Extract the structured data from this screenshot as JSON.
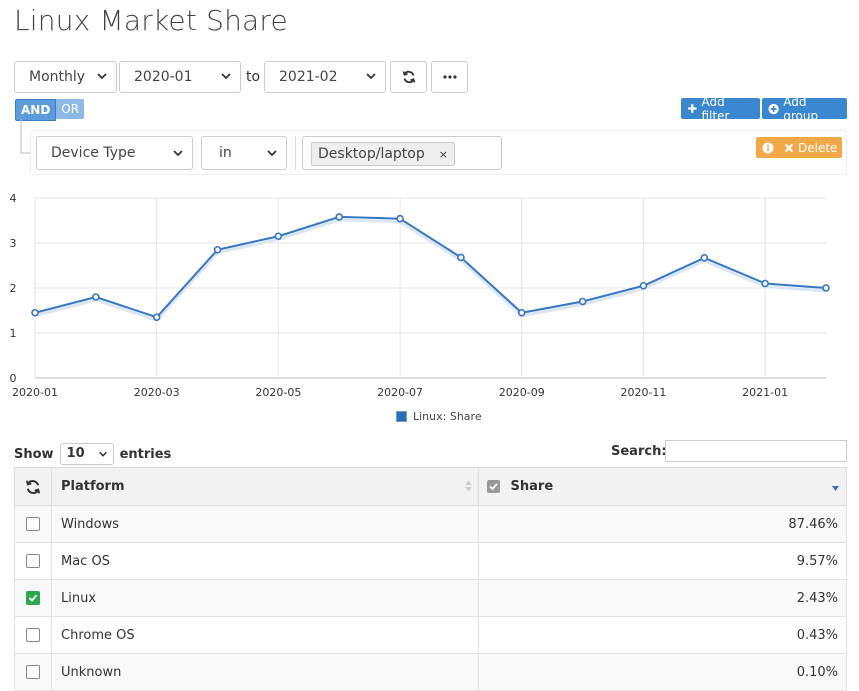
{
  "page": {
    "title": "Linux Market Share"
  },
  "toolbar": {
    "period": "Monthly",
    "from": "2020-01",
    "to_label": "to",
    "to": "2021-02"
  },
  "filter": {
    "and_label": "AND",
    "or_label": "OR",
    "add_filter": "Add filter",
    "add_group": "Add group",
    "field": "Device Type",
    "operator": "in",
    "value_tag": "Desktop/laptop",
    "tag_remove": "×",
    "delete": "Delete"
  },
  "chart_data": {
    "type": "line",
    "x": [
      "2020-01",
      "2020-02",
      "2020-03",
      "2020-04",
      "2020-05",
      "2020-06",
      "2020-07",
      "2020-08",
      "2020-09",
      "2020-10",
      "2020-11",
      "2020-12",
      "2021-01",
      "2021-02"
    ],
    "series": [
      {
        "name": "Linux: Share",
        "values": [
          1.45,
          1.8,
          1.35,
          2.85,
          3.15,
          3.58,
          3.54,
          2.68,
          1.45,
          1.7,
          2.05,
          2.67,
          2.1,
          2.0
        ]
      }
    ],
    "xtick_labels": [
      "2020-01",
      "2020-03",
      "2020-05",
      "2020-07",
      "2020-09",
      "2020-11",
      "2021-01"
    ],
    "ytick_labels": [
      "0",
      "1",
      "2",
      "3",
      "4"
    ],
    "ylim": [
      0,
      4
    ],
    "grid": true,
    "legend": "bottom",
    "line_color": "#3576c2"
  },
  "table": {
    "show_label": "Show",
    "entries_value": "10",
    "entries_label": "entries",
    "search_label": "Search:",
    "columns": [
      "Platform",
      "Share"
    ],
    "rows": [
      {
        "platform": "Windows",
        "share": "87.46%",
        "checked": false
      },
      {
        "platform": "Mac OS",
        "share": "9.57%",
        "checked": false
      },
      {
        "platform": "Linux",
        "share": "2.43%",
        "checked": true
      },
      {
        "platform": "Chrome OS",
        "share": "0.43%",
        "checked": false
      },
      {
        "platform": "Unknown",
        "share": "0.10%",
        "checked": false
      }
    ]
  },
  "colors": {
    "primary": "#3a87d0",
    "warning": "#f3a847",
    "checked": "#2ea84d"
  }
}
